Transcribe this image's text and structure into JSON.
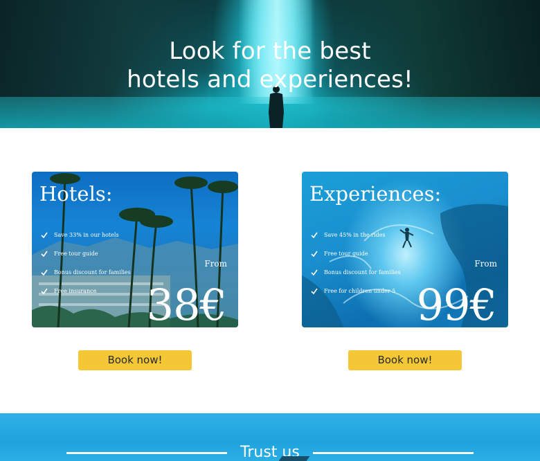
{
  "hero": {
    "title_line1": "Look for the best",
    "title_line2": "hotels and experiences!"
  },
  "cards": [
    {
      "title": "Hotels:",
      "features": [
        "Save 33% in our hotels",
        "Free tour guide",
        "Bonus discount for families",
        "Free insurance"
      ],
      "from_label": "From",
      "price": "38€",
      "button_label": "Book now!"
    },
    {
      "title": "Experiences:",
      "features": [
        "Save 45% in the rides",
        "Free tour guide",
        "Bonus discount for families",
        "Free for children under 5"
      ],
      "from_label": "From",
      "price": "99€",
      "button_label": "Book now!"
    }
  ],
  "trust": {
    "title": "Trust us"
  },
  "colors": {
    "button": "#f4c737",
    "trust_band": "#1fa3de",
    "text_light": "#ffffff"
  },
  "icons": [
    "check-icon"
  ]
}
